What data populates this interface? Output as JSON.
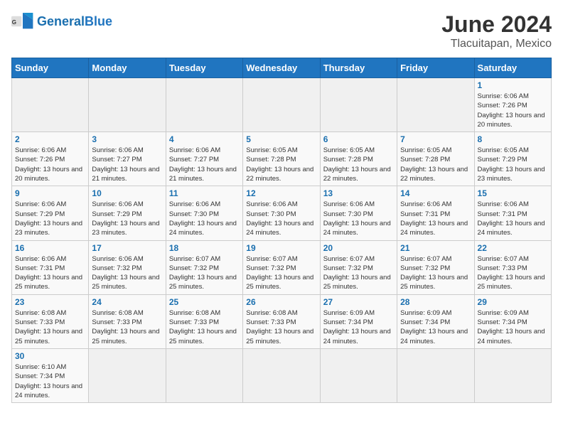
{
  "header": {
    "logo_general": "General",
    "logo_blue": "Blue",
    "month_year": "June 2024",
    "location": "Tlacuitapan, Mexico"
  },
  "weekdays": [
    "Sunday",
    "Monday",
    "Tuesday",
    "Wednesday",
    "Thursday",
    "Friday",
    "Saturday"
  ],
  "weeks": [
    [
      {
        "day": null
      },
      {
        "day": null
      },
      {
        "day": null
      },
      {
        "day": null
      },
      {
        "day": null
      },
      {
        "day": null
      },
      {
        "day": 1,
        "sunrise": "Sunrise: 6:06 AM",
        "sunset": "Sunset: 7:26 PM",
        "daylight": "Daylight: 13 hours and 20 minutes."
      }
    ],
    [
      {
        "day": 2,
        "sunrise": "Sunrise: 6:06 AM",
        "sunset": "Sunset: 7:26 PM",
        "daylight": "Daylight: 13 hours and 20 minutes."
      },
      {
        "day": 3,
        "sunrise": "Sunrise: 6:06 AM",
        "sunset": "Sunset: 7:27 PM",
        "daylight": "Daylight: 13 hours and 21 minutes."
      },
      {
        "day": 4,
        "sunrise": "Sunrise: 6:06 AM",
        "sunset": "Sunset: 7:27 PM",
        "daylight": "Daylight: 13 hours and 21 minutes."
      },
      {
        "day": 5,
        "sunrise": "Sunrise: 6:05 AM",
        "sunset": "Sunset: 7:28 PM",
        "daylight": "Daylight: 13 hours and 22 minutes."
      },
      {
        "day": 6,
        "sunrise": "Sunrise: 6:05 AM",
        "sunset": "Sunset: 7:28 PM",
        "daylight": "Daylight: 13 hours and 22 minutes."
      },
      {
        "day": 7,
        "sunrise": "Sunrise: 6:05 AM",
        "sunset": "Sunset: 7:28 PM",
        "daylight": "Daylight: 13 hours and 22 minutes."
      },
      {
        "day": 8,
        "sunrise": "Sunrise: 6:05 AM",
        "sunset": "Sunset: 7:29 PM",
        "daylight": "Daylight: 13 hours and 23 minutes."
      }
    ],
    [
      {
        "day": 9,
        "sunrise": "Sunrise: 6:06 AM",
        "sunset": "Sunset: 7:29 PM",
        "daylight": "Daylight: 13 hours and 23 minutes."
      },
      {
        "day": 10,
        "sunrise": "Sunrise: 6:06 AM",
        "sunset": "Sunset: 7:29 PM",
        "daylight": "Daylight: 13 hours and 23 minutes."
      },
      {
        "day": 11,
        "sunrise": "Sunrise: 6:06 AM",
        "sunset": "Sunset: 7:30 PM",
        "daylight": "Daylight: 13 hours and 24 minutes."
      },
      {
        "day": 12,
        "sunrise": "Sunrise: 6:06 AM",
        "sunset": "Sunset: 7:30 PM",
        "daylight": "Daylight: 13 hours and 24 minutes."
      },
      {
        "day": 13,
        "sunrise": "Sunrise: 6:06 AM",
        "sunset": "Sunset: 7:30 PM",
        "daylight": "Daylight: 13 hours and 24 minutes."
      },
      {
        "day": 14,
        "sunrise": "Sunrise: 6:06 AM",
        "sunset": "Sunset: 7:31 PM",
        "daylight": "Daylight: 13 hours and 24 minutes."
      },
      {
        "day": 15,
        "sunrise": "Sunrise: 6:06 AM",
        "sunset": "Sunset: 7:31 PM",
        "daylight": "Daylight: 13 hours and 24 minutes."
      }
    ],
    [
      {
        "day": 16,
        "sunrise": "Sunrise: 6:06 AM",
        "sunset": "Sunset: 7:31 PM",
        "daylight": "Daylight: 13 hours and 25 minutes."
      },
      {
        "day": 17,
        "sunrise": "Sunrise: 6:06 AM",
        "sunset": "Sunset: 7:32 PM",
        "daylight": "Daylight: 13 hours and 25 minutes."
      },
      {
        "day": 18,
        "sunrise": "Sunrise: 6:07 AM",
        "sunset": "Sunset: 7:32 PM",
        "daylight": "Daylight: 13 hours and 25 minutes."
      },
      {
        "day": 19,
        "sunrise": "Sunrise: 6:07 AM",
        "sunset": "Sunset: 7:32 PM",
        "daylight": "Daylight: 13 hours and 25 minutes."
      },
      {
        "day": 20,
        "sunrise": "Sunrise: 6:07 AM",
        "sunset": "Sunset: 7:32 PM",
        "daylight": "Daylight: 13 hours and 25 minutes."
      },
      {
        "day": 21,
        "sunrise": "Sunrise: 6:07 AM",
        "sunset": "Sunset: 7:32 PM",
        "daylight": "Daylight: 13 hours and 25 minutes."
      },
      {
        "day": 22,
        "sunrise": "Sunrise: 6:07 AM",
        "sunset": "Sunset: 7:33 PM",
        "daylight": "Daylight: 13 hours and 25 minutes."
      }
    ],
    [
      {
        "day": 23,
        "sunrise": "Sunrise: 6:08 AM",
        "sunset": "Sunset: 7:33 PM",
        "daylight": "Daylight: 13 hours and 25 minutes."
      },
      {
        "day": 24,
        "sunrise": "Sunrise: 6:08 AM",
        "sunset": "Sunset: 7:33 PM",
        "daylight": "Daylight: 13 hours and 25 minutes."
      },
      {
        "day": 25,
        "sunrise": "Sunrise: 6:08 AM",
        "sunset": "Sunset: 7:33 PM",
        "daylight": "Daylight: 13 hours and 25 minutes."
      },
      {
        "day": 26,
        "sunrise": "Sunrise: 6:08 AM",
        "sunset": "Sunset: 7:33 PM",
        "daylight": "Daylight: 13 hours and 25 minutes."
      },
      {
        "day": 27,
        "sunrise": "Sunrise: 6:09 AM",
        "sunset": "Sunset: 7:34 PM",
        "daylight": "Daylight: 13 hours and 24 minutes."
      },
      {
        "day": 28,
        "sunrise": "Sunrise: 6:09 AM",
        "sunset": "Sunset: 7:34 PM",
        "daylight": "Daylight: 13 hours and 24 minutes."
      },
      {
        "day": 29,
        "sunrise": "Sunrise: 6:09 AM",
        "sunset": "Sunset: 7:34 PM",
        "daylight": "Daylight: 13 hours and 24 minutes."
      }
    ],
    [
      {
        "day": 30,
        "sunrise": "Sunrise: 6:10 AM",
        "sunset": "Sunset: 7:34 PM",
        "daylight": "Daylight: 13 hours and 24 minutes."
      },
      {
        "day": null
      },
      {
        "day": null
      },
      {
        "day": null
      },
      {
        "day": null
      },
      {
        "day": null
      },
      {
        "day": null
      }
    ]
  ]
}
